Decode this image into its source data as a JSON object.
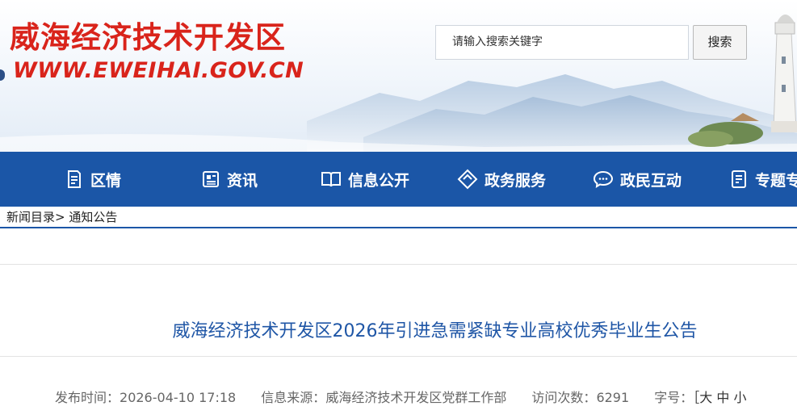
{
  "header": {
    "site_title": "威海经济技术开发区",
    "site_url": "WWW.EWEIHAI.GOV.CN",
    "search_placeholder": "请输入搜索关键字",
    "search_button": "搜索"
  },
  "nav": {
    "items": [
      {
        "label": "区情",
        "icon": "document-icon"
      },
      {
        "label": "资讯",
        "icon": "news-icon"
      },
      {
        "label": "信息公开",
        "icon": "book-icon"
      },
      {
        "label": "政务服务",
        "icon": "diamond-icon"
      },
      {
        "label": "政民互动",
        "icon": "chat-icon"
      },
      {
        "label": "专题专",
        "icon": "topic-icon"
      }
    ]
  },
  "breadcrumb": {
    "root": "新闻目录",
    "separator": ">",
    "current": "通知公告"
  },
  "article": {
    "title": "威海经济技术开发区2026年引进急需紧缺专业高校优秀毕业生公告",
    "publish_label": "发布时间：",
    "publish_time": "2026-04-10 17:18",
    "source_label": "信息来源：",
    "source": "威海经济技术开发区党群工作部",
    "visits_label": "访问次数：",
    "visits": "6291",
    "fontsize_label": "字号：",
    "fontsize_options": "［大 中 小"
  },
  "colors": {
    "brand_red": "#d9241b",
    "nav_blue": "#1b56a7",
    "title_blue": "#1f56a6"
  }
}
